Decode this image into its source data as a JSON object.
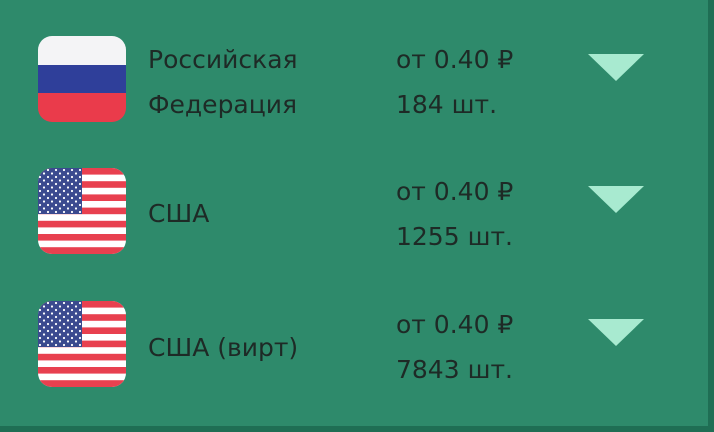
{
  "countries": [
    {
      "name_line1": "Российская",
      "name_line2": "Федерация",
      "price": "от 0.40 ₽",
      "count": "184 шт.",
      "flag_icon": "russia-flag-icon"
    },
    {
      "name_line1": "США",
      "name_line2": "",
      "price": "от 0.40 ₽",
      "count": "1255 шт.",
      "flag_icon": "usa-flag-icon"
    },
    {
      "name_line1": "США (вирт)",
      "name_line2": "",
      "price": "от 0.40 ₽",
      "count": "7843 шт.",
      "flag_icon": "usa-flag-icon"
    }
  ],
  "colors": {
    "background": "#2e8a6b",
    "text": "#1e2a26",
    "expand_arrow": "#a8ead0"
  }
}
